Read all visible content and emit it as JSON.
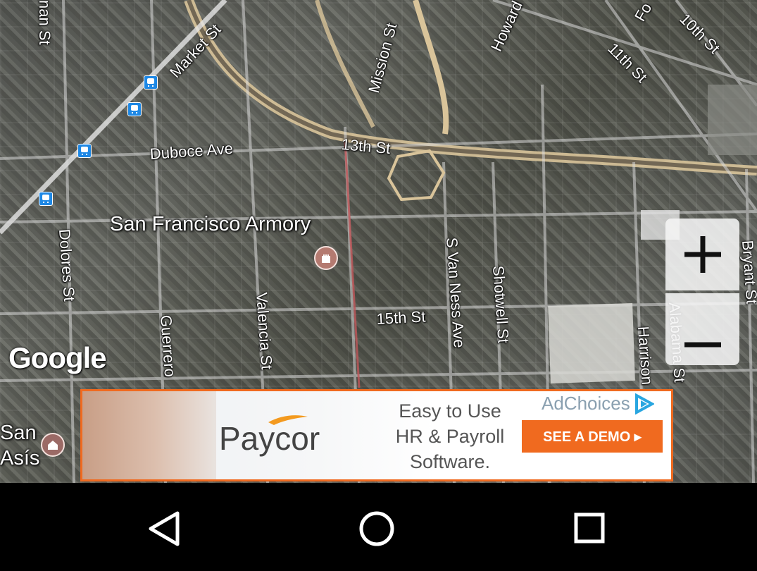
{
  "map": {
    "streets": {
      "market": "Market St",
      "mission": "Mission St",
      "howard": "Howard",
      "folsom": "Fo",
      "tenth": "10th St",
      "eleventh": "11th St",
      "duboce": "Duboce Ave",
      "thirteenth": "13th St",
      "fifteenth": "15th St",
      "dolores": "Dolores St",
      "guerrero": "Guerrero",
      "valencia": "Valencia St",
      "van_ness": "S Van Ness Ave",
      "shotwell": "Shotwell St",
      "harrison": "Harrison",
      "alabama": "Alabama St",
      "bryant": "Bryant St",
      "buchanan": "nan St"
    },
    "places": {
      "armory": "San Francisco Armory",
      "mission_dolores_line1": "San",
      "mission_dolores_line2": "Asís"
    },
    "attribution": "Google",
    "zoom_in_label": "+",
    "zoom_out_label": "−"
  },
  "ad": {
    "brand": "Paycor",
    "tagline": [
      "Easy to Use",
      "HR & Payroll",
      "Software."
    ],
    "adchoices": "AdChoices",
    "cta": "SEE A DEMO ▸",
    "accent_color": "#f06a1f"
  },
  "navbar": {
    "back_icon": "back-triangle-icon",
    "home_icon": "home-circle-icon",
    "recents_icon": "recents-square-icon"
  }
}
